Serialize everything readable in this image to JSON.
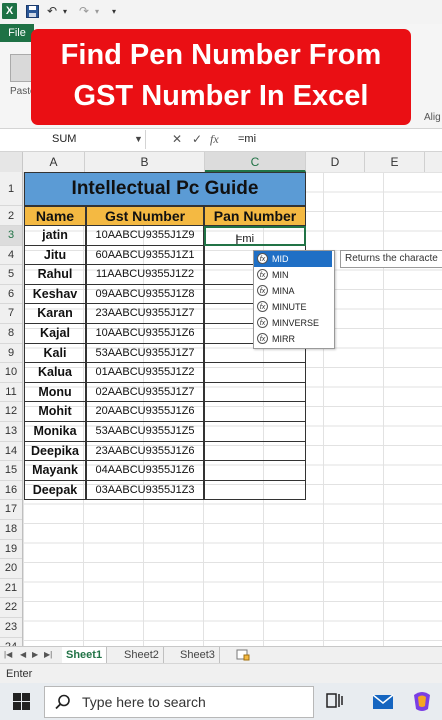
{
  "qat": {
    "undo_arrow": "↶",
    "redo_arrow": "↷",
    "customize": "▾"
  },
  "ribbon": {
    "file_tab": "File",
    "paste_label": "Paste",
    "align_label": "Alig"
  },
  "banner": {
    "line1": "Find Pen Number From",
    "line2": "GST Number In Excel"
  },
  "formula_bar": {
    "name_box": "SUM",
    "cancel": "✕",
    "enter": "✓",
    "fx": "fx",
    "value": "=mi"
  },
  "columns": [
    "A",
    "B",
    "C",
    "D",
    "E"
  ],
  "rows": [
    "1",
    "2",
    "3",
    "4",
    "5",
    "6",
    "7",
    "8",
    "9",
    "10",
    "11",
    "12",
    "13",
    "14",
    "15",
    "16",
    "17",
    "18",
    "19",
    "20",
    "21",
    "22",
    "23",
    "24"
  ],
  "table": {
    "title": "Intellectual Pc Guide",
    "headers": [
      "Name",
      "Gst Number",
      "Pan Number"
    ],
    "data": [
      {
        "name": "jatin",
        "gst": "10AABCU9355J1Z9"
      },
      {
        "name": "Jitu",
        "gst": "60AABCU9355J1Z1"
      },
      {
        "name": "Rahul",
        "gst": "11AABCU9355J1Z2"
      },
      {
        "name": "Keshav",
        "gst": "09AABCU9355J1Z8"
      },
      {
        "name": "Karan",
        "gst": "23AABCU9355J1Z7"
      },
      {
        "name": "Kajal",
        "gst": "10AABCU9355J1Z6"
      },
      {
        "name": "Kali",
        "gst": "53AABCU9355J1Z7"
      },
      {
        "name": "Kalua",
        "gst": "01AABCU9355J1Z2"
      },
      {
        "name": "Monu",
        "gst": "02AABCU9355J1Z7"
      },
      {
        "name": "Mohit",
        "gst": "20AABCU9355J1Z6"
      },
      {
        "name": "Monika",
        "gst": "53AABCU9355J1Z5"
      },
      {
        "name": "Deepika",
        "gst": "23AABCU9355J1Z6"
      },
      {
        "name": "Mayank",
        "gst": "04AABCU9355J1Z6"
      },
      {
        "name": "Deepak",
        "gst": "03AABCU9355J1Z3"
      }
    ],
    "active_cell_value": "=mi"
  },
  "autocomplete": {
    "items": [
      "MID",
      "MIN",
      "MINA",
      "MINUTE",
      "MINVERSE",
      "MIRR"
    ],
    "selected_index": 0,
    "tooltip": "Returns the characte"
  },
  "sheets": {
    "tabs": [
      "Sheet1",
      "Sheet2",
      "Sheet3"
    ],
    "active_index": 0
  },
  "status": {
    "mode": "Enter"
  },
  "taskbar": {
    "search_placeholder": "Type here to search"
  },
  "colors": {
    "banner": "#ea0f14",
    "title_fill": "#5b9bd5",
    "header_fill": "#f4b942",
    "excel_green": "#217346",
    "ac_selected": "#1f6fc5"
  }
}
